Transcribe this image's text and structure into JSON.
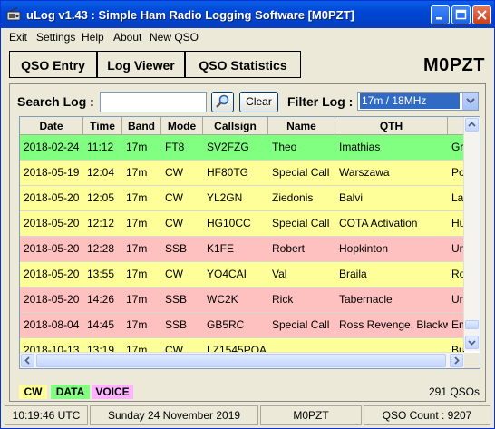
{
  "window": {
    "title": "uLog v1.43 : Simple Ham Radio Logging Software     [M0PZT]"
  },
  "menu": {
    "items": [
      "Exit",
      "Settings",
      "Help",
      "About",
      "New QSO"
    ]
  },
  "tabs": [
    "QSO Entry",
    "Log Viewer",
    "QSO Statistics"
  ],
  "header_callsign": "M0PZT",
  "search": {
    "label": "Search Log :",
    "value": "",
    "clear_label": "Clear"
  },
  "filter": {
    "label": "Filter Log :",
    "selected": "17m / 18MHz"
  },
  "columns": [
    "Date",
    "Time",
    "Band",
    "Mode",
    "Callsign",
    "Name",
    "QTH"
  ],
  "rows": [
    {
      "date": "2018-02-24",
      "time": "11:12",
      "band": "17m",
      "mode": "FT8",
      "callsign": "SV2FZG",
      "name": "Theo",
      "qth": "Imathias",
      "country": "Gre",
      "type": "data"
    },
    {
      "date": "2018-05-19",
      "time": "12:04",
      "band": "17m",
      "mode": "CW",
      "callsign": "HF80TG",
      "name": "Special Call",
      "qth": "Warszawa",
      "country": "Pola",
      "type": "cw"
    },
    {
      "date": "2018-05-20",
      "time": "12:05",
      "band": "17m",
      "mode": "CW",
      "callsign": "YL2GN",
      "name": "Ziedonis",
      "qth": "Balvi",
      "country": "Latv",
      "type": "cw"
    },
    {
      "date": "2018-05-20",
      "time": "12:12",
      "band": "17m",
      "mode": "CW",
      "callsign": "HG10CC",
      "name": "Special Call",
      "qth": "COTA Activation",
      "country": "Hun",
      "type": "cw"
    },
    {
      "date": "2018-05-20",
      "time": "12:28",
      "band": "17m",
      "mode": "SSB",
      "callsign": "K1FE",
      "name": "Robert",
      "qth": "Hopkinton",
      "country": "Unit",
      "type": "voice"
    },
    {
      "date": "2018-05-20",
      "time": "13:55",
      "band": "17m",
      "mode": "CW",
      "callsign": "YO4CAI",
      "name": "Val",
      "qth": "Braila",
      "country": "Rom",
      "type": "cw"
    },
    {
      "date": "2018-05-20",
      "time": "14:26",
      "band": "17m",
      "mode": "SSB",
      "callsign": "WC2K",
      "name": "Rick",
      "qth": "Tabernacle",
      "country": "Unit",
      "type": "voice"
    },
    {
      "date": "2018-08-04",
      "time": "14:45",
      "band": "17m",
      "mode": "SSB",
      "callsign": "GB5RC",
      "name": "Special Call",
      "qth": "Ross Revenge, Blackw...",
      "country": "Eng",
      "type": "voice"
    },
    {
      "date": "2018-10-13",
      "time": "13:19",
      "band": "17m",
      "mode": "CW",
      "callsign": "LZ1545POA",
      "name": "",
      "qth": "",
      "country": "Bulg",
      "type": "cw"
    }
  ],
  "legend": [
    {
      "label": "CW",
      "color": "#ffff99"
    },
    {
      "label": "DATA",
      "color": "#80ff80"
    },
    {
      "label": "VOICE",
      "color": "#ffb3ff"
    }
  ],
  "row_colors": {
    "cw": "#ffff99",
    "data": "#80ff80",
    "voice": "#ffc0c0"
  },
  "qso_total": "291 QSOs",
  "status": {
    "time": "10:19:46  UTC",
    "date": "Sunday 24 November 2019",
    "callsign": "M0PZT",
    "count": "QSO Count : 9207"
  }
}
